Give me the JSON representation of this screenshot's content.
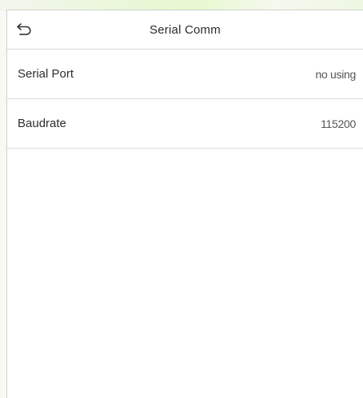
{
  "header": {
    "title": "Serial Comm",
    "back_icon": "back-arrow-icon"
  },
  "settings": [
    {
      "label": "Serial Port",
      "value": "no using"
    },
    {
      "label": "Baudrate",
      "value": "115200"
    }
  ]
}
